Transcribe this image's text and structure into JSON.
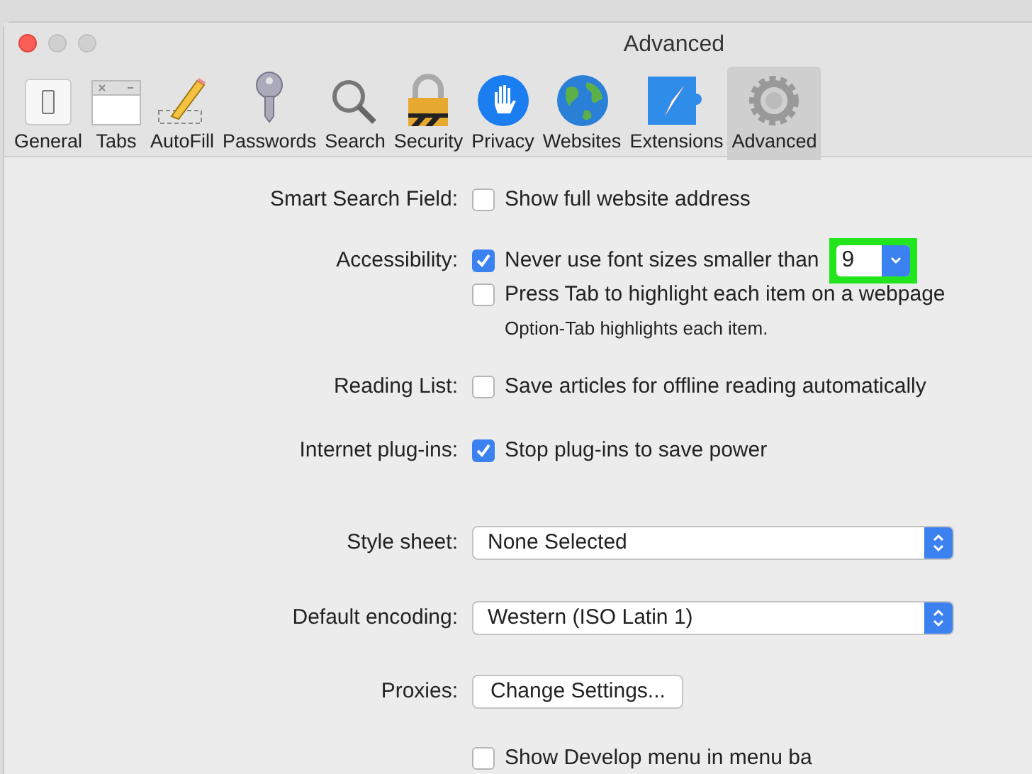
{
  "window": {
    "title": "Advanced"
  },
  "toolbar": [
    {
      "label": "General",
      "selected": false
    },
    {
      "label": "Tabs",
      "selected": false
    },
    {
      "label": "AutoFill",
      "selected": false
    },
    {
      "label": "Passwords",
      "selected": false
    },
    {
      "label": "Search",
      "selected": false
    },
    {
      "label": "Security",
      "selected": false
    },
    {
      "label": "Privacy",
      "selected": false
    },
    {
      "label": "Websites",
      "selected": false
    },
    {
      "label": "Extensions",
      "selected": false
    },
    {
      "label": "Advanced",
      "selected": true
    }
  ],
  "settings": [
    {
      "kind": "checkbox",
      "label": "Smart Search Field:",
      "options": [
        {
          "text": "Show full website address",
          "checked": false
        }
      ]
    },
    {
      "kind": "checkbox",
      "label": "Accessibility:",
      "options": [
        {
          "text": "Never use font sizes smaller than",
          "checked": true,
          "size": {
            "value": "9",
            "highlighted": true
          }
        },
        {
          "text": "Press Tab to highlight each item on a webpage",
          "checked": false,
          "note": "Option-Tab highlights each item."
        }
      ]
    },
    {
      "kind": "checkbox",
      "label": "Reading List:",
      "options": [
        {
          "text": "Save articles for offline reading automatically",
          "checked": false
        }
      ]
    },
    {
      "kind": "checkbox",
      "label": "Internet plug-ins:",
      "options": [
        {
          "text": "Stop plug-ins to save power",
          "checked": true
        }
      ]
    },
    {
      "kind": "select",
      "label": "Style sheet:",
      "value": "None Selected"
    },
    {
      "kind": "select",
      "label": "Default encoding:",
      "value": "Western (ISO Latin 1)"
    },
    {
      "kind": "button",
      "label": "Proxies:",
      "value": "Change Settings..."
    },
    {
      "kind": "checkbox",
      "options": [
        {
          "text": "Show Develop menu in menu ba",
          "checked": false
        }
      ]
    }
  ]
}
